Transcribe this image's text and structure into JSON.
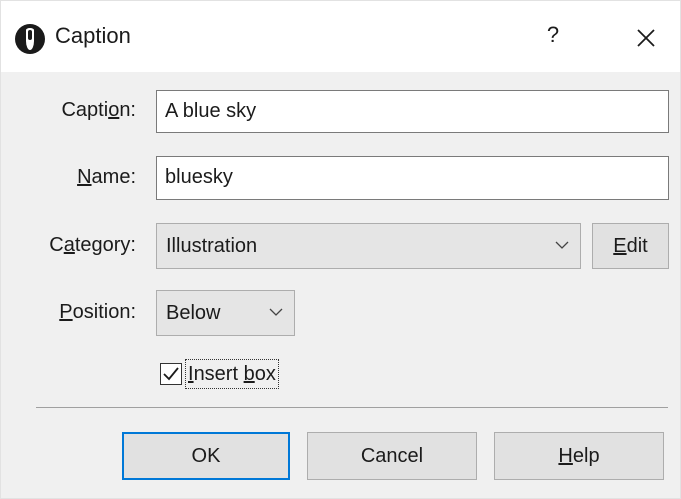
{
  "window": {
    "title": "Caption",
    "help_glyph": "?",
    "app_icon": "info-icon",
    "close_icon": "close-icon"
  },
  "form": {
    "caption": {
      "label_pre": "Capti",
      "label_key": "o",
      "label_post": "n:",
      "value": "A blue sky"
    },
    "name": {
      "label_key": "N",
      "label_post": "ame:",
      "value": "bluesky"
    },
    "category": {
      "label_pre": "C",
      "label_key": "a",
      "label_post": "tegory:",
      "value": "Illustration",
      "edit_key": "E",
      "edit_post": "dit"
    },
    "position": {
      "label_key": "P",
      "label_post": "osition:",
      "value": "Below"
    },
    "insert_box": {
      "key": "I",
      "rest_pre": "nsert ",
      "rest_key": "b",
      "rest_post": "ox",
      "checked": true
    }
  },
  "buttons": {
    "ok": "OK",
    "cancel": "Cancel",
    "help_key": "H",
    "help_post": "elp"
  },
  "colors": {
    "focus_border": "#0078d7",
    "dialog_bg": "#f0f0f0",
    "titlebar_bg": "#ffffff"
  }
}
